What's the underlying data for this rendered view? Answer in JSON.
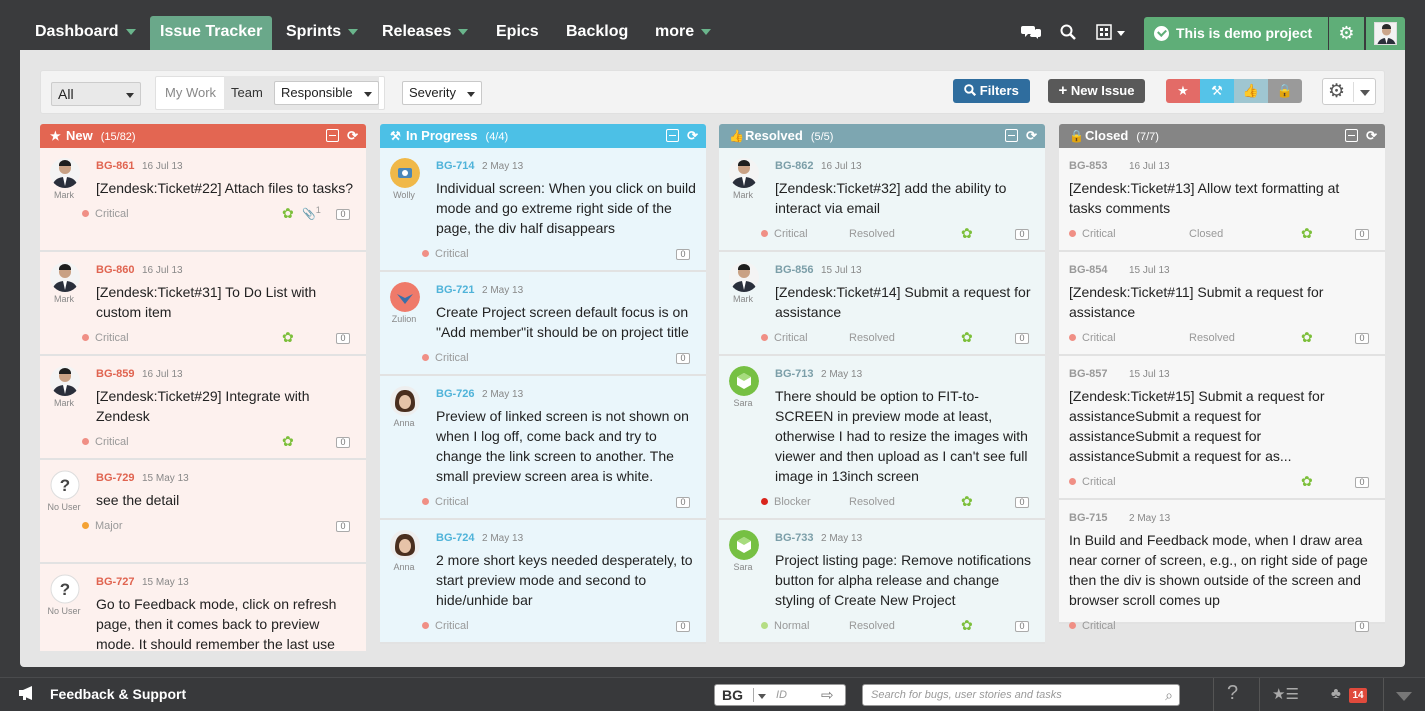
{
  "nav": {
    "items": [
      {
        "label": "Dashboard",
        "caret": true
      },
      {
        "label": "Issue Tracker",
        "caret": false,
        "active": true
      },
      {
        "label": "Sprints",
        "caret": true
      },
      {
        "label": "Releases",
        "caret": true
      },
      {
        "label": "Epics",
        "caret": false
      },
      {
        "label": "Backlog",
        "caret": false
      },
      {
        "label": "more",
        "caret": true
      }
    ],
    "demo_label": "This is demo project"
  },
  "toolbar": {
    "scope_select": "All",
    "my_work": "My Work",
    "team": "Team",
    "responsible": "Responsible",
    "severity": "Severity",
    "filters": "Filters",
    "new_issue": "New Issue"
  },
  "columns": [
    {
      "key": "new",
      "title": "New",
      "count": "(15/82)",
      "color": "#e36652",
      "cards": [
        {
          "id": "BG-861",
          "date": "16 Jul 13",
          "user": "Mark",
          "title": "[Zendesk:Ticket#22] Attach files to tasks?",
          "severity": "Critical",
          "sev_color": "#f08f85",
          "status": "",
          "attach": "1",
          "comments": "0"
        },
        {
          "id": "BG-860",
          "date": "16 Jul 13",
          "user": "Mark",
          "title": "[Zendesk:Ticket#31] To Do List with custom item",
          "severity": "Critical",
          "sev_color": "#f08f85",
          "status": "",
          "attach": "",
          "comments": "0"
        },
        {
          "id": "BG-859",
          "date": "16 Jul 13",
          "user": "Mark",
          "title": "[Zendesk:Ticket#29] Integrate with Zendesk",
          "severity": "Critical",
          "sev_color": "#f08f85",
          "status": "",
          "attach": "",
          "comments": "0"
        },
        {
          "id": "BG-729",
          "date": "15 May 13",
          "user": "No User",
          "title": "see the detail",
          "severity": "Major",
          "sev_color": "#f4a234",
          "status": "",
          "attach": "",
          "comments": "0"
        },
        {
          "id": "BG-727",
          "date": "15 May 13",
          "user": "No User",
          "title": "Go to Feedback mode, click on refresh page, then it comes back to preview mode. It should remember the last use",
          "severity": "",
          "sev_color": "",
          "status": "",
          "attach": "",
          "comments": ""
        }
      ]
    },
    {
      "key": "prog",
      "title": "In Progress",
      "count": "(4/4)",
      "color": "#4cc0e6",
      "cards": [
        {
          "id": "BG-714",
          "date": "2 May 13",
          "user": "Wolly",
          "title": "Individual screen: When you click on build mode and go extreme right side of the page, the div half disappears",
          "severity": "Critical",
          "sev_color": "#f08f85",
          "status": "",
          "attach": "",
          "comments": "0"
        },
        {
          "id": "BG-721",
          "date": "2 May 13",
          "user": "Zulion",
          "title": "Create Project screen default focus is on \"Add member\"it should be on project title",
          "severity": "Critical",
          "sev_color": "#f08f85",
          "status": "",
          "attach": "",
          "comments": "0"
        },
        {
          "id": "BG-726",
          "date": "2 May 13",
          "user": "Anna",
          "title": "Preview of linked screen is not shown on when I log off, come back and try to change the link screen to another. The small preview screen area is white.",
          "severity": "Critical",
          "sev_color": "#f08f85",
          "status": "",
          "attach": "",
          "comments": "0"
        },
        {
          "id": "BG-724",
          "date": "2 May 13",
          "user": "Anna",
          "title": "2 more short keys needed desperately, to start preview mode and second to hide/unhide bar",
          "severity": "Critical",
          "sev_color": "#f08f85",
          "status": "",
          "attach": "",
          "comments": "0"
        }
      ]
    },
    {
      "key": "res",
      "title": "Resolved",
      "count": "(5/5)",
      "color": "#7da6b1",
      "cards": [
        {
          "id": "BG-862",
          "date": "16 Jul 13",
          "user": "Mark",
          "title": "[Zendesk:Ticket#32] add the ability to interact via email",
          "severity": "Critical",
          "sev_color": "#f08f85",
          "status": "Resolved",
          "attach": "",
          "comments": "0"
        },
        {
          "id": "BG-856",
          "date": "15 Jul 13",
          "user": "Mark",
          "title": "[Zendesk:Ticket#14] Submit a request for assistance",
          "severity": "Critical",
          "sev_color": "#f08f85",
          "status": "Resolved",
          "attach": "",
          "comments": "0"
        },
        {
          "id": "BG-713",
          "date": "2 May 13",
          "user": "Sara",
          "title": "There should be option to FIT-to-SCREEN in preview mode at least, otherwise I had to resize the images with viewer and then upload as I can't see full image in 13inch screen",
          "severity": "Blocker",
          "sev_color": "#d9251c",
          "status": "Resolved",
          "attach": "",
          "comments": "0"
        },
        {
          "id": "BG-733",
          "date": "2 May 13",
          "user": "Sara",
          "title": "Project listing page: Remove notifications button for alpha release and change styling of Create New Project",
          "severity": "Normal",
          "sev_color": "#b5dd84",
          "status": "Resolved",
          "attach": "",
          "comments": "0"
        }
      ]
    },
    {
      "key": "closed",
      "title": "Closed",
      "count": "(7/7)",
      "color": "#858585",
      "cards": [
        {
          "id": "BG-853",
          "date": "16 Jul 13",
          "user": "",
          "title": "[Zendesk:Ticket#13] Allow text formatting at tasks comments",
          "severity": "Critical",
          "sev_color": "#f08f85",
          "status": "Closed",
          "attach": "",
          "comments": "0"
        },
        {
          "id": "BG-854",
          "date": "15 Jul 13",
          "user": "",
          "title": "[Zendesk:Ticket#11] Submit a request for assistance",
          "severity": "Critical",
          "sev_color": "#f08f85",
          "status": "Resolved",
          "attach": "",
          "comments": "0"
        },
        {
          "id": "BG-857",
          "date": "15 Jul 13",
          "user": "",
          "title": "[Zendesk:Ticket#15] Submit a request for assistanceSubmit a request for assistanceSubmit a request for assistanceSubmit a request for as...",
          "severity": "Critical",
          "sev_color": "#f08f85",
          "status": "",
          "attach": "",
          "comments": "0"
        },
        {
          "id": "BG-715",
          "date": "2 May 13",
          "user": "",
          "title": "In Build and Feedback mode, when I draw area near corner of screen, e.g., on right side of page then the div is shown outside of the screen and browser scroll comes up",
          "severity": "Critical",
          "sev_color": "#f08f85",
          "status": "",
          "attach": "",
          "comments": "0"
        }
      ]
    }
  ],
  "footer": {
    "feedback": "Feedback & Support",
    "project_code": "BG",
    "id_placeholder": "ID",
    "search_placeholder": "Search for bugs, user stories and tasks",
    "badge": "14"
  }
}
